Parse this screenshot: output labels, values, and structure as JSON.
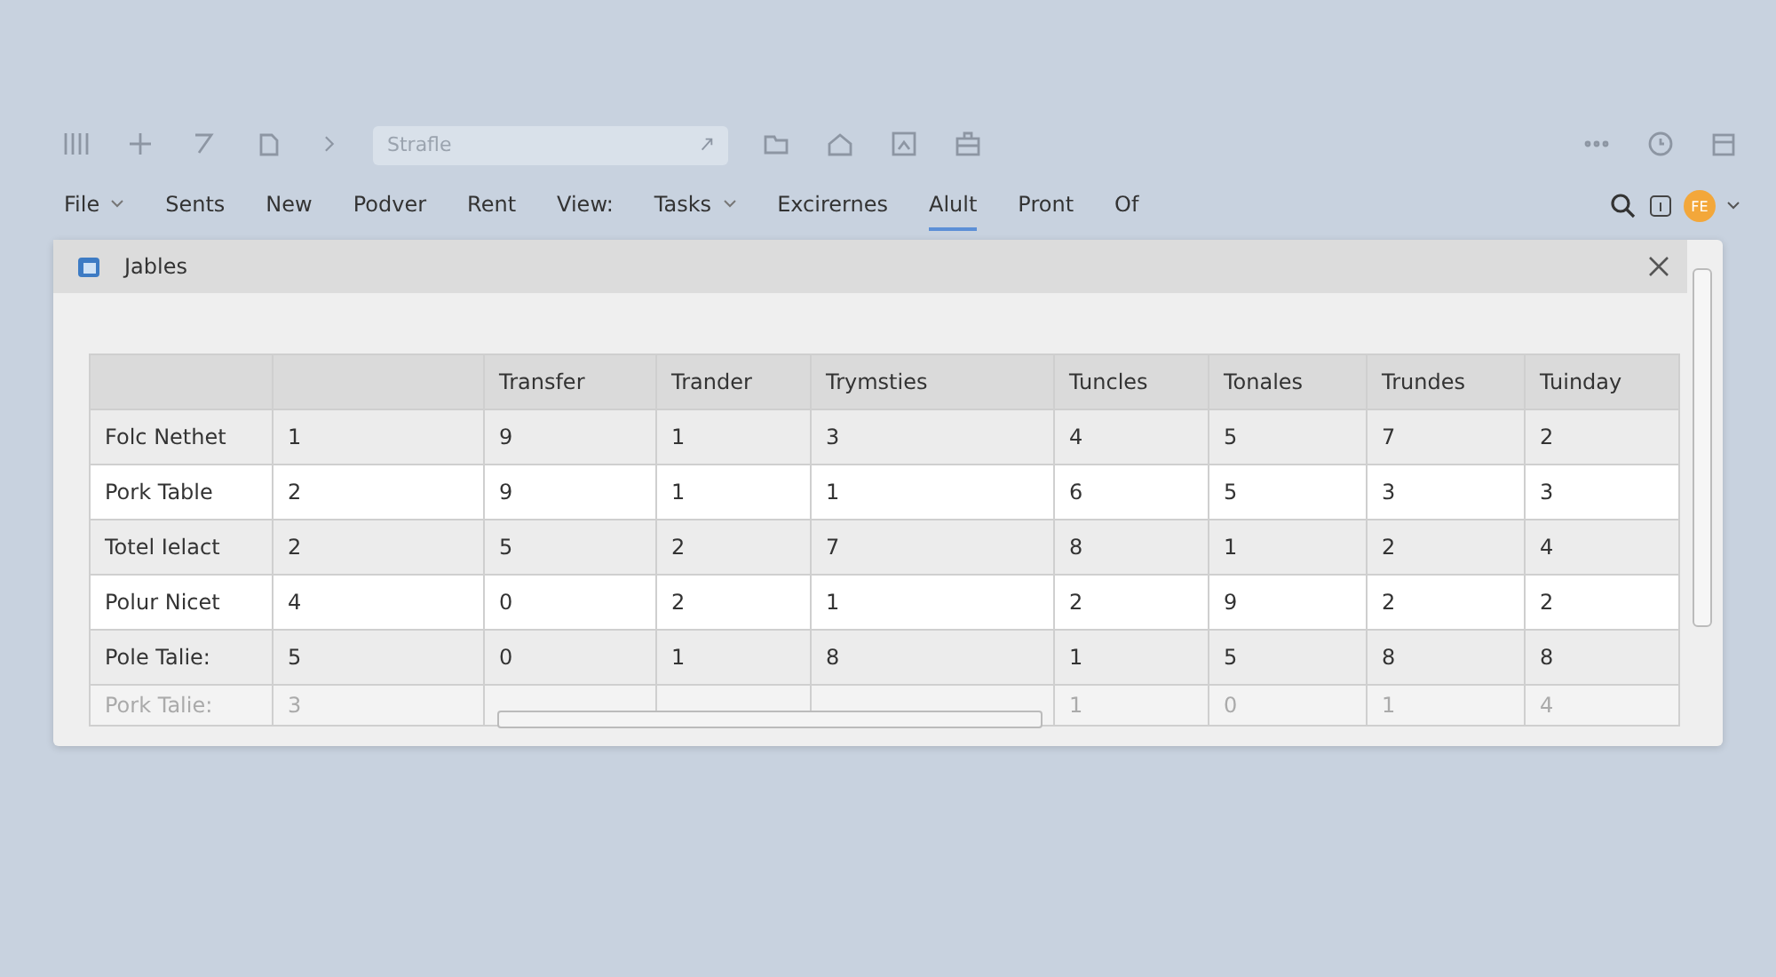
{
  "toolbar": {
    "search": {
      "placeholder": "Strafle"
    }
  },
  "menu": [
    {
      "label": "File",
      "dropdown": true,
      "selected": false
    },
    {
      "label": "Sents",
      "dropdown": false,
      "selected": false
    },
    {
      "label": "New",
      "dropdown": false,
      "selected": false
    },
    {
      "label": "Podver",
      "dropdown": false,
      "selected": false
    },
    {
      "label": "Rent",
      "dropdown": false,
      "selected": false
    },
    {
      "label": "View:",
      "dropdown": false,
      "selected": false
    },
    {
      "label": "Tasks",
      "dropdown": true,
      "selected": false
    },
    {
      "label": "Excirernes",
      "dropdown": false,
      "selected": false
    },
    {
      "label": "Alult",
      "dropdown": false,
      "selected": true
    },
    {
      "label": "Pront",
      "dropdown": false,
      "selected": false
    },
    {
      "label": "Of",
      "dropdown": false,
      "selected": false
    }
  ],
  "account": {
    "initials": "FE"
  },
  "dialog": {
    "title": "Jables",
    "table": {
      "columns": [
        "",
        "Transfer",
        "Trander",
        "Trymsties",
        "Tuncles",
        "Tonales",
        "Trundes",
        "Tuinday"
      ],
      "rows": [
        {
          "label": "Folc Nethet",
          "cells": [
            "1",
            "9",
            "1",
            "3",
            "4",
            "5",
            "7",
            "2"
          ],
          "dimmed": false
        },
        {
          "label": "Pork Table",
          "cells": [
            "2",
            "9",
            "1",
            "1",
            "6",
            "5",
            "3",
            "3"
          ],
          "dimmed": false
        },
        {
          "label": "Totel Ielact",
          "cells": [
            "2",
            "5",
            "2",
            "7",
            "8",
            "1",
            "2",
            "4"
          ],
          "dimmed": false
        },
        {
          "label": "Polur Nicet",
          "cells": [
            "4",
            "0",
            "2",
            "1",
            "2",
            "9",
            "2",
            "2"
          ],
          "dimmed": false
        },
        {
          "label": "Pole Talie:",
          "cells": [
            "5",
            "0",
            "1",
            "8",
            "1",
            "5",
            "8",
            "8"
          ],
          "dimmed": false
        },
        {
          "label": "Pork Talie:",
          "cells": [
            "3",
            null,
            null,
            null,
            "1",
            "0",
            "1",
            "4"
          ],
          "dimmed": true
        }
      ]
    }
  }
}
